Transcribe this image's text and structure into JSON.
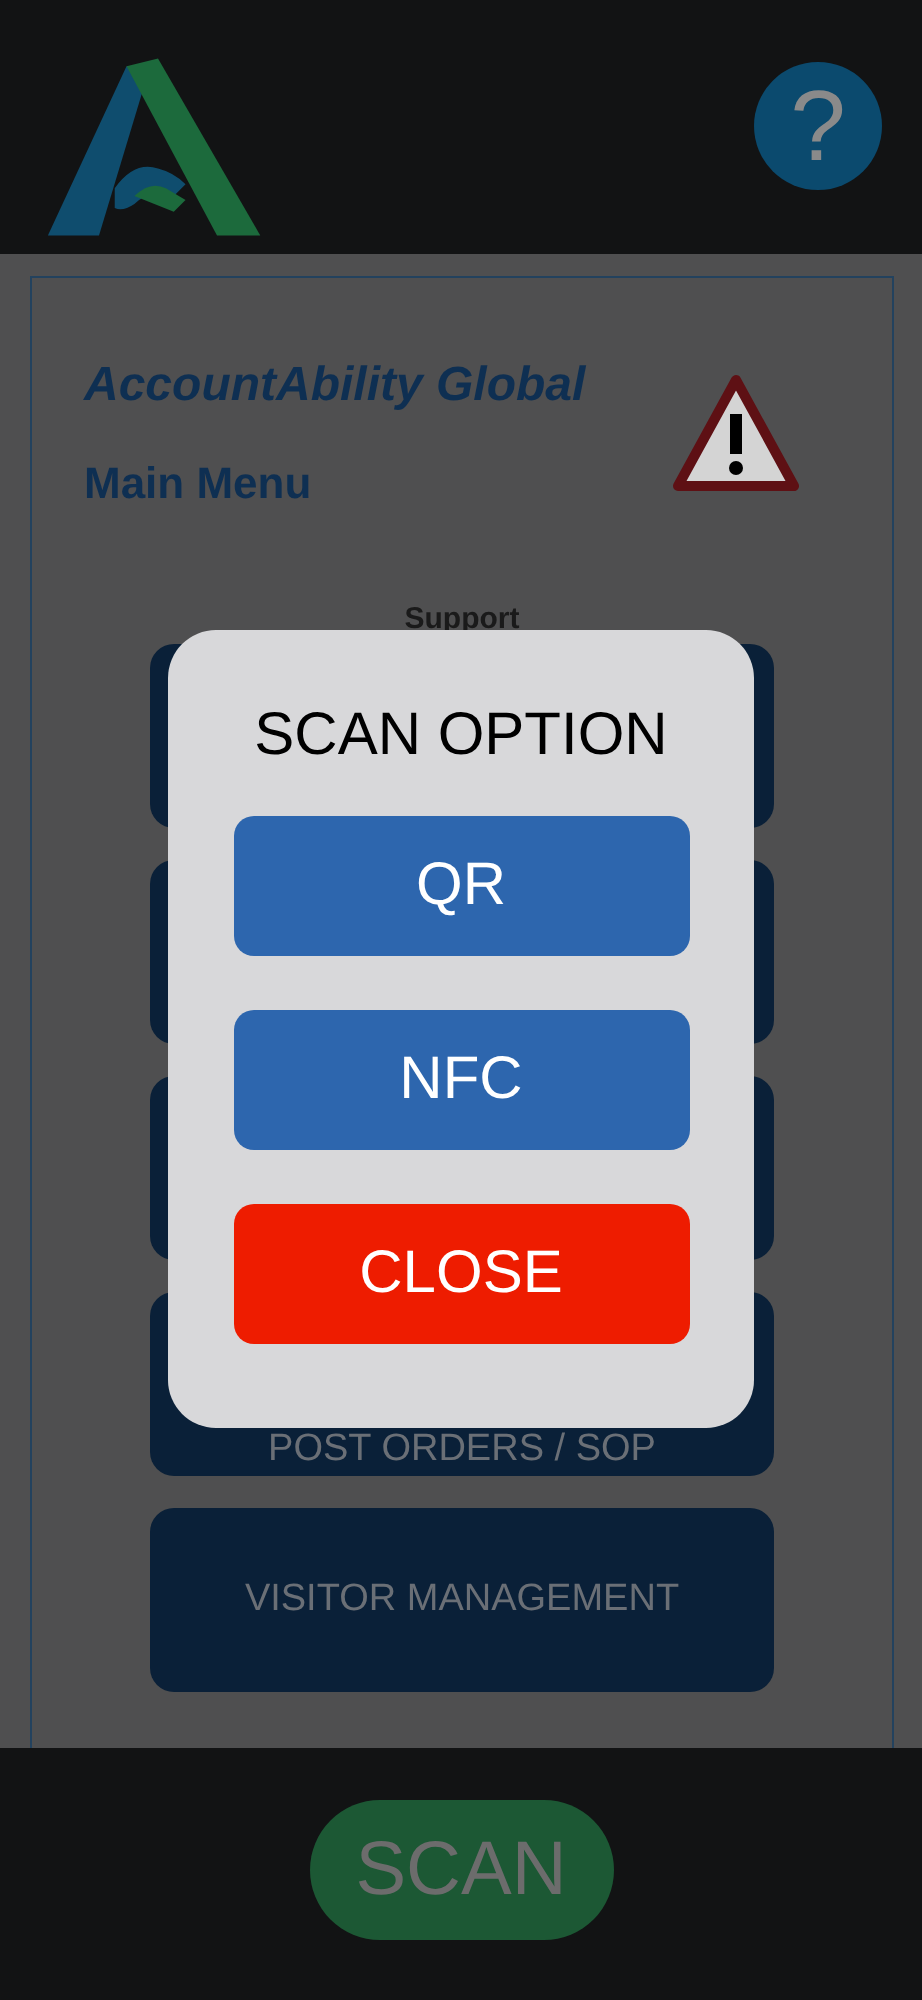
{
  "header": {
    "help_label": "?"
  },
  "card": {
    "company": "AccountAbility Global",
    "title": "Main Menu",
    "section": "Support"
  },
  "menu": [
    {
      "kind": "covered"
    },
    {
      "kind": "covered"
    },
    {
      "kind": "covered"
    },
    {
      "kind": "labelled",
      "label": "POST ORDERS / SOP"
    },
    {
      "kind": "labelled",
      "label": "VISITOR MANAGEMENT"
    }
  ],
  "dialog": {
    "title": "SCAN OPTION",
    "buttons": [
      {
        "label": "QR",
        "kind": "option"
      },
      {
        "label": "NFC",
        "kind": "option"
      },
      {
        "label": "CLOSE",
        "kind": "close"
      }
    ]
  },
  "footer": {
    "scan": "SCAN"
  }
}
